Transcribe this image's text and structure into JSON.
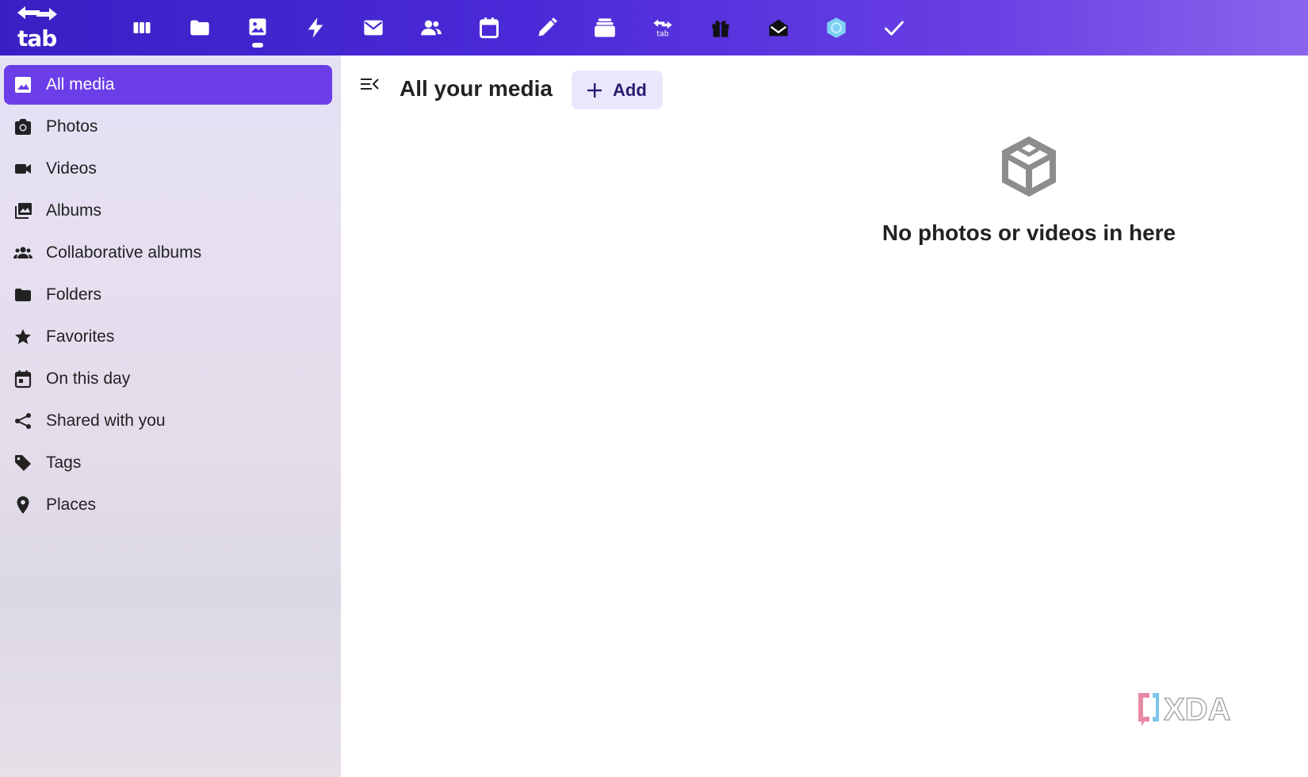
{
  "logo": {
    "text": "tab"
  },
  "topbar": {
    "apps": [
      {
        "name": "dashboard",
        "icon": "dashboard-icon"
      },
      {
        "name": "files",
        "icon": "folder-icon"
      },
      {
        "name": "photos",
        "icon": "photos-icon",
        "active": true
      },
      {
        "name": "activity",
        "icon": "lightning-icon"
      },
      {
        "name": "mail",
        "icon": "mail-icon"
      },
      {
        "name": "contacts",
        "icon": "contacts-icon"
      },
      {
        "name": "calendar",
        "icon": "calendar-icon"
      },
      {
        "name": "notes",
        "icon": "pencil-icon"
      },
      {
        "name": "deck",
        "icon": "stack-icon"
      },
      {
        "name": "tab",
        "icon": "tab-logo-icon"
      },
      {
        "name": "gifts",
        "icon": "gift-icon"
      },
      {
        "name": "inbox",
        "icon": "open-envelope-icon"
      },
      {
        "name": "hub",
        "icon": "hexagon-icon"
      },
      {
        "name": "tasks",
        "icon": "check-icon"
      }
    ]
  },
  "sidebar": {
    "items": [
      {
        "label": "All media",
        "icon": "image-icon",
        "active": true
      },
      {
        "label": "Photos",
        "icon": "camera-icon"
      },
      {
        "label": "Videos",
        "icon": "video-icon"
      },
      {
        "label": "Albums",
        "icon": "albums-icon"
      },
      {
        "label": "Collaborative albums",
        "icon": "group-icon"
      },
      {
        "label": "Folders",
        "icon": "folder-icon"
      },
      {
        "label": "Favorites",
        "icon": "star-icon"
      },
      {
        "label": "On this day",
        "icon": "calendar-icon"
      },
      {
        "label": "Shared with you",
        "icon": "share-icon"
      },
      {
        "label": "Tags",
        "icon": "tag-icon"
      },
      {
        "label": "Places",
        "icon": "map-pin-icon"
      }
    ]
  },
  "main": {
    "title": "All your media",
    "add_label": "Add",
    "empty_message": "No photos or videos in here"
  },
  "watermark": {
    "text": "XDA"
  },
  "colors": {
    "topbar_start": "#3a1fc4",
    "topbar_end": "#8a64ec",
    "active_item": "#6b3ee8",
    "add_button_bg": "#ebe6fb",
    "add_button_text": "#2a1a6e"
  }
}
